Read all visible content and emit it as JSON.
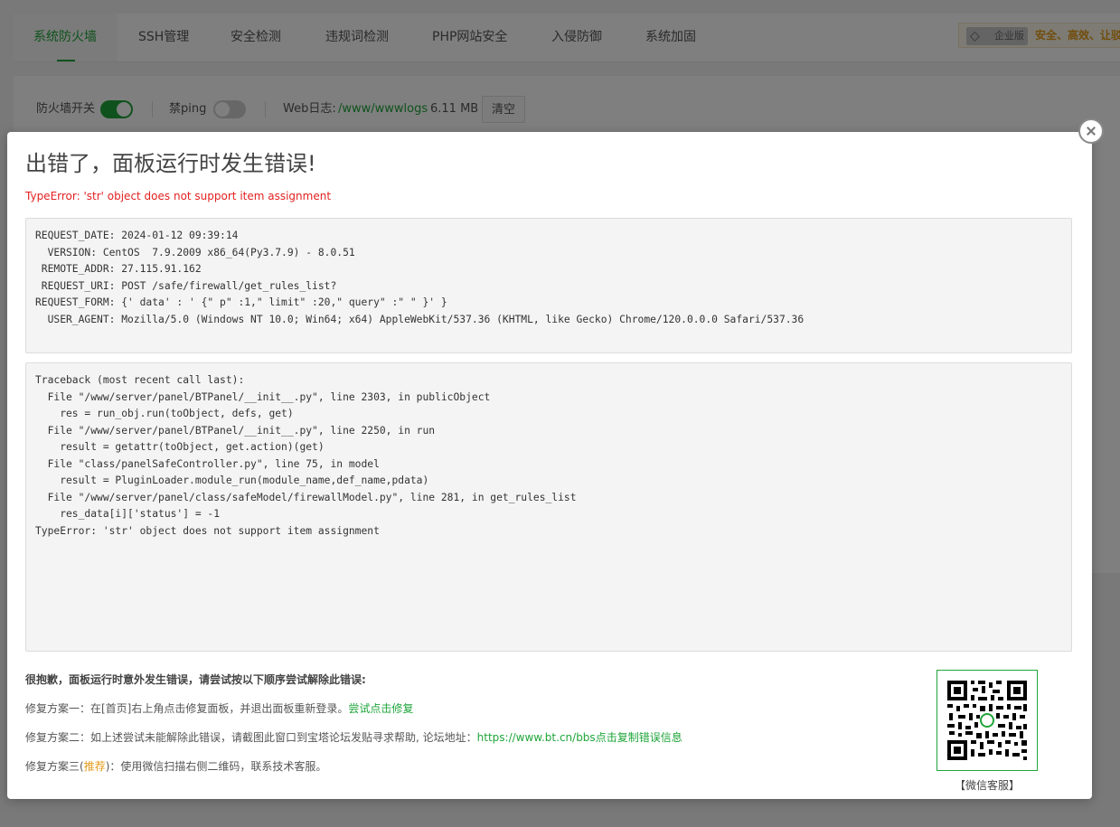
{
  "tabs": [
    {
      "label": "系统防火墙",
      "active": true
    },
    {
      "label": "SSH管理",
      "active": false
    },
    {
      "label": "安全检测",
      "active": false
    },
    {
      "label": "违规词检测",
      "active": false
    },
    {
      "label": "PHP网站安全",
      "active": false
    },
    {
      "label": "入侵防御",
      "active": false
    },
    {
      "label": "系统加固",
      "active": false
    }
  ],
  "promo": {
    "badge": "企业版",
    "text": "安全、高效、让驳",
    "badge_icon": "diamond-icon"
  },
  "firewall_bar": {
    "firewall_switch_label": "防火墙开关",
    "firewall_switch_on": true,
    "ping_label": "禁ping",
    "ping_on": false,
    "weblog_label": "Web日志:",
    "weblog_path": "/www/wwwlogs",
    "weblog_size": "6.11 MB",
    "clear_label": "清空"
  },
  "error_dialog": {
    "title": "出错了，面板运行时发生错误!",
    "subtitle": "TypeError: 'str' object does not support item assignment",
    "request_lines": [
      "REQUEST_DATE: 2024-01-12 09:39:14",
      "  VERSION: CentOS  7.9.2009 x86_64(Py3.7.9) - 8.0.51",
      " REMOTE_ADDR: 27.115.91.162",
      " REQUEST_URI: POST /safe/firewall/get_rules_list?",
      "REQUEST_FORM: {' data' : ' {\" p\" :1,\" limit\" :20,\" query\" :\" \" }' }",
      "  USER_AGENT: Mozilla/5.0 (Windows NT 10.0; Win64; x64) AppleWebKit/537.36 (KHTML, like Gecko) Chrome/120.0.0.0 Safari/537.36"
    ],
    "traceback_lines": [
      "Traceback (most recent call last):",
      "  File \"/www/server/panel/BTPanel/__init__.py\", line 2303, in publicObject",
      "    res = run_obj.run(toObject, defs, get)",
      "  File \"/www/server/panel/BTPanel/__init__.py\", line 2250, in run",
      "    result = getattr(toObject, get.action)(get)",
      "  File \"class/panelSafeController.py\", line 75, in model",
      "    result = PluginLoader.module_run(module_name,def_name,pdata)",
      "  File \"/www/server/panel/class/safeModel/firewallModel.py\", line 281, in get_rules_list",
      "    res_data[i]['status'] = -1",
      "TypeError: 'str' object does not support item assignment"
    ],
    "help_heading": "很抱歉，面板运行时意外发生错误，请尝试按以下顺序尝试解除此错误:",
    "fix1_text": "修复方案一：在[首页]右上角点击修复面板，并退出面板重新登录。",
    "fix1_link": "尝试点击修复",
    "fix2_text": "修复方案二：如上述尝试未能解除此错误，请截图此窗口到宝塔论坛发贴寻求帮助, 论坛地址：",
    "fix2_url": "https://www.bt.cn/bbs",
    "fix2_link": "点击复制错误信息",
    "fix3_prefix": "修复方案三(",
    "fix3_tag": "推荐",
    "fix3_suffix": ")：使用微信扫描右侧二维码，联系技术客服。",
    "qr_caption": "【微信客服】"
  }
}
